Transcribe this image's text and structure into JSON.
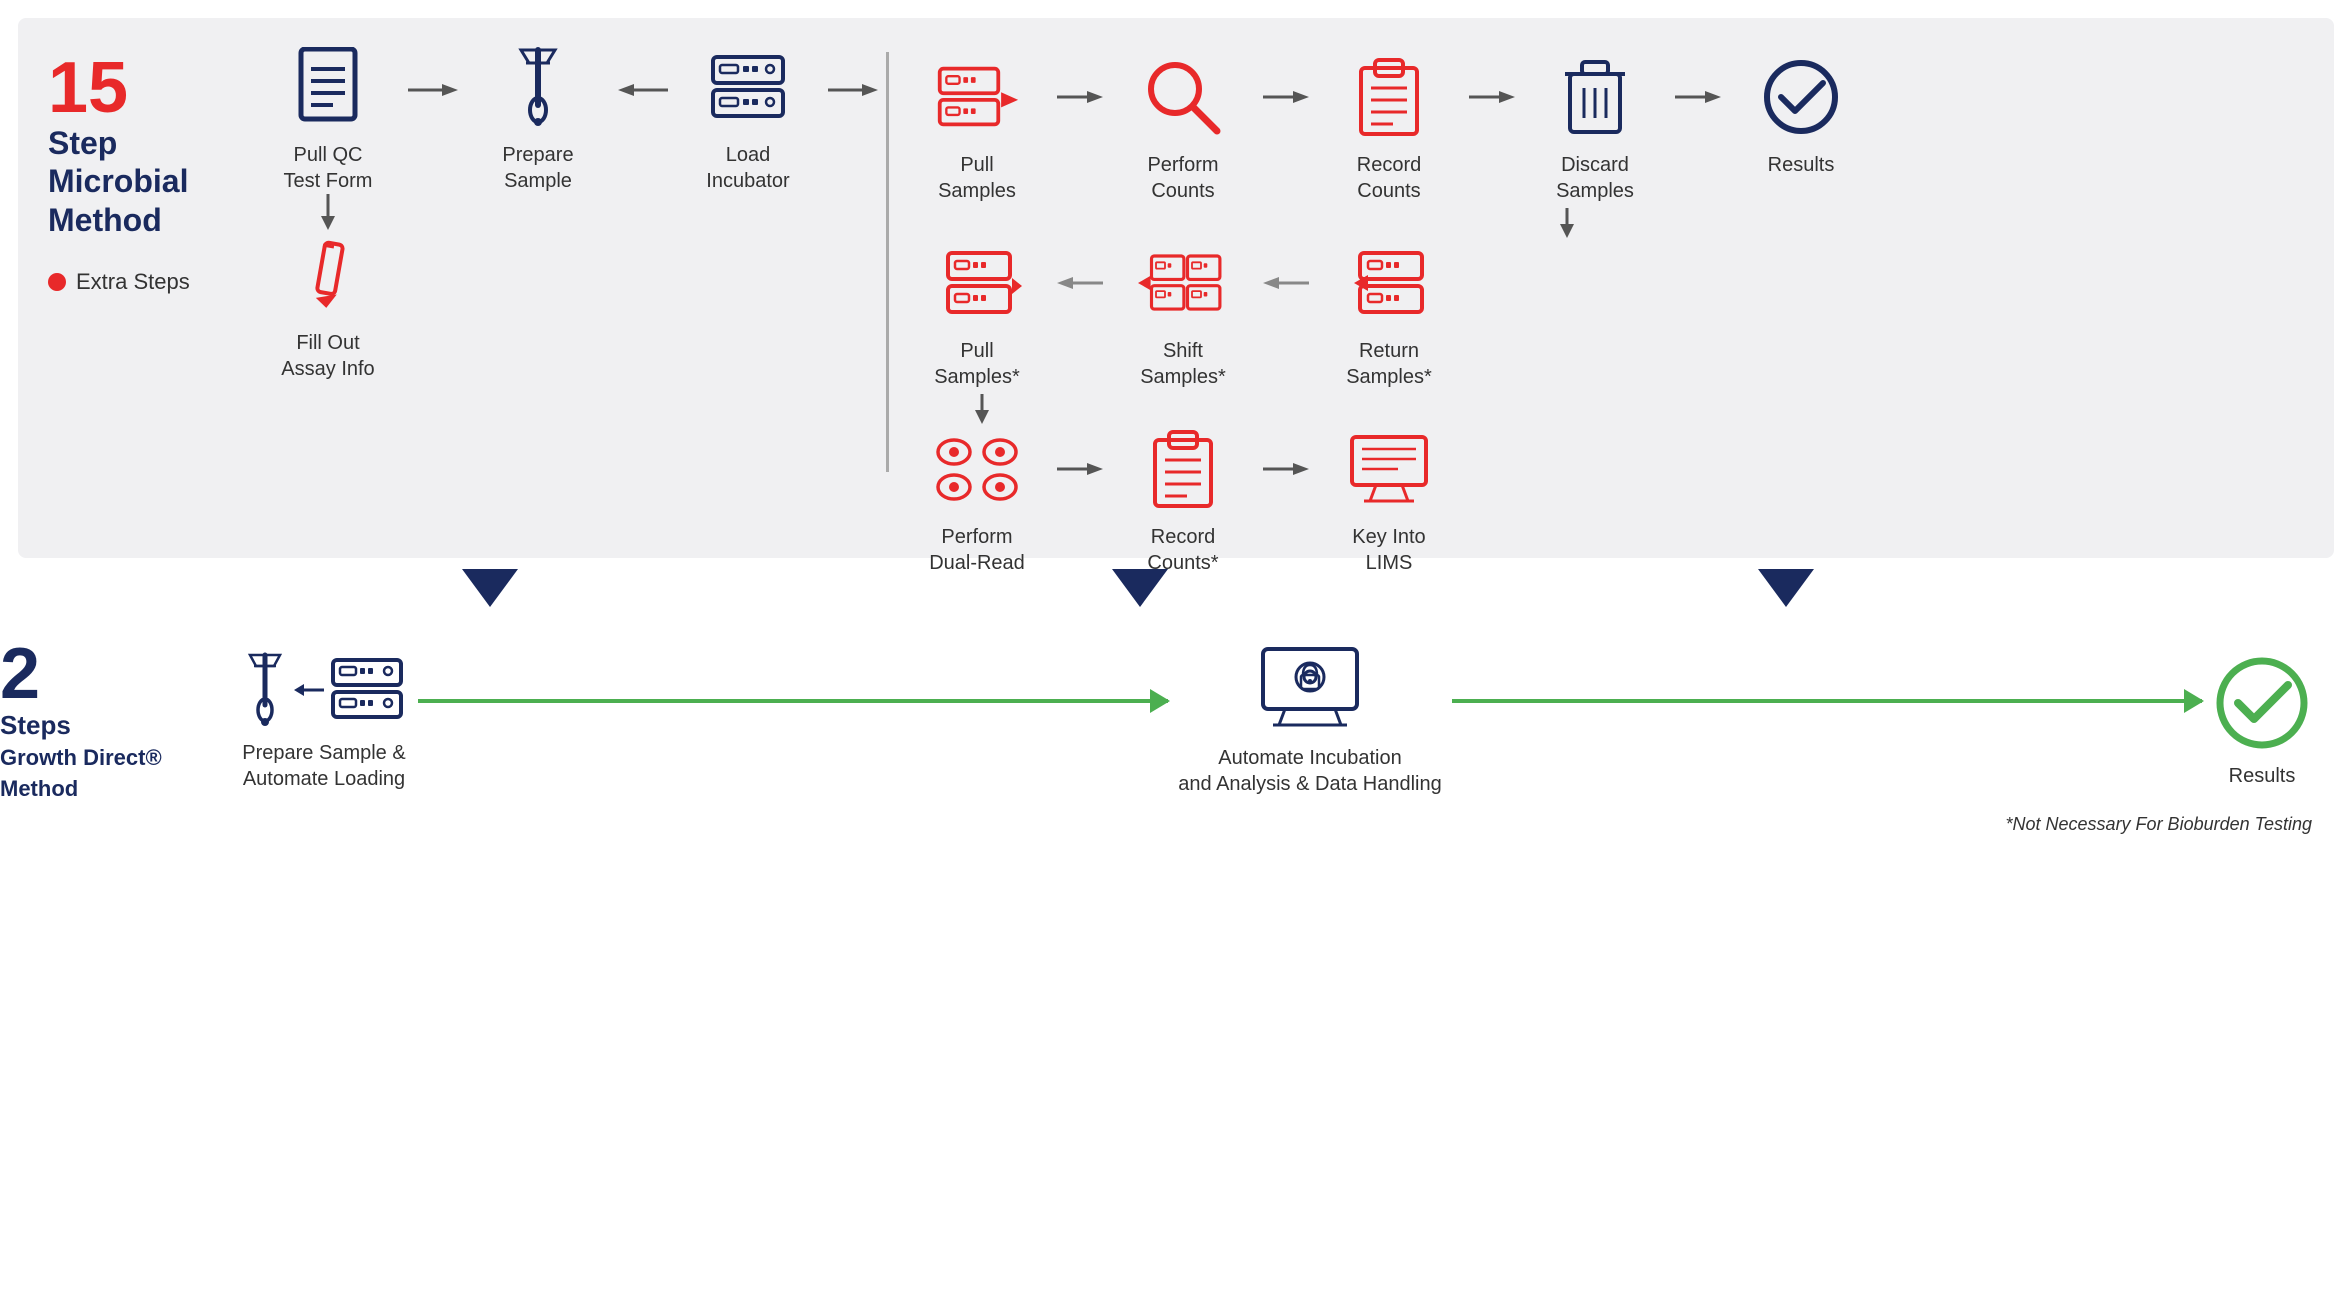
{
  "title": "15 Step Microbial Method",
  "step_number": "15",
  "step_label": "Step\nMicrobial\nMethod",
  "extra_steps_label": "Extra Steps",
  "top_flow": {
    "steps_row1": [
      {
        "id": "pull-qc",
        "label": "Pull QC\nTest Form",
        "icon": "document"
      },
      {
        "id": "prepare-sample",
        "label": "Prepare\nSample",
        "icon": "pipette"
      },
      {
        "id": "load-incubator",
        "label": "Load\nIncubator",
        "icon": "server"
      },
      {
        "id": "pull-samples",
        "label": "Pull\nSamples",
        "icon": "server-red"
      },
      {
        "id": "perform-counts",
        "label": "Perform\nCounts",
        "icon": "search"
      },
      {
        "id": "record-counts",
        "label": "Record\nCounts",
        "icon": "clipboard"
      },
      {
        "id": "discard-samples",
        "label": "Discard\nSamples",
        "icon": "trash"
      },
      {
        "id": "results",
        "label": "Results",
        "icon": "check-circle"
      }
    ],
    "steps_row2": [
      {
        "id": "pull-samples-star",
        "label": "Pull\nSamples*",
        "icon": "server-red-arrow"
      },
      {
        "id": "shift-samples",
        "label": "Shift\nSamples*",
        "icon": "server-double"
      },
      {
        "id": "return-samples",
        "label": "Return\nSamples*",
        "icon": "server-red-left"
      }
    ],
    "steps_row3": [
      {
        "id": "perform-dual-read",
        "label": "Perform\nDual-Read",
        "icon": "eyes"
      },
      {
        "id": "record-counts-star",
        "label": "Record\nCounts*",
        "icon": "clipboard-red"
      },
      {
        "id": "key-into-lims",
        "label": "Key Into\nLIMS",
        "icon": "monitor"
      }
    ],
    "fill-out": {
      "label": "Fill Out\nAssay Info",
      "icon": "pencil"
    }
  },
  "bottom_section": {
    "title_num": "2",
    "title_text": "Steps\nGrowth Direct®\nMethod",
    "step1_label": "Prepare Sample &\nAutomate Loading",
    "step2_label": "Automate Incubation\nand Analysis & Data Handling",
    "step3_label": "Results"
  },
  "footnote": "*Not Necessary For Bioburden Testing"
}
